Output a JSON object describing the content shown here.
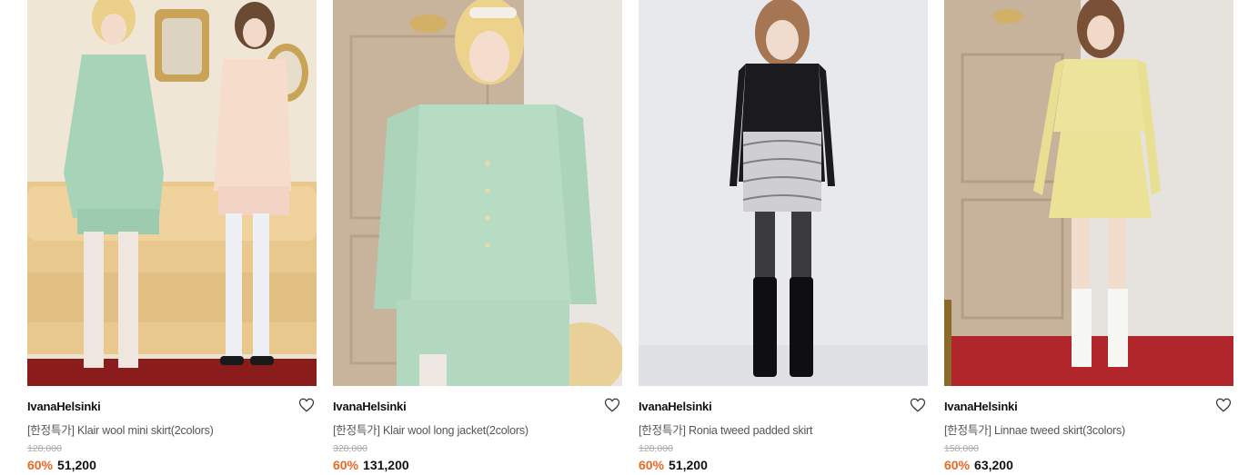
{
  "products": [
    {
      "brand": "IvanaHelsinki",
      "title": "[한정특가] Klair wool mini skirt(2colors)",
      "original_price": "128,000",
      "discount": "60%",
      "price": "51,200",
      "heart_icon": "heart-outline-icon"
    },
    {
      "brand": "IvanaHelsinki",
      "title": "[한정특가] Klair wool long jacket(2colors)",
      "original_price": "328,000",
      "discount": "60%",
      "price": "131,200",
      "heart_icon": "heart-outline-icon"
    },
    {
      "brand": "IvanaHelsinki",
      "title": "[한정특가] Ronia tweed padded skirt",
      "original_price": "128,000",
      "discount": "60%",
      "price": "51,200",
      "heart_icon": "heart-outline-icon"
    },
    {
      "brand": "IvanaHelsinki",
      "title": "[한정특가] Linnae tweed skirt(3colors)",
      "original_price": "158,000",
      "discount": "60%",
      "price": "63,200",
      "heart_icon": "heart-outline-icon"
    }
  ],
  "colors": {
    "discount": "#f26522",
    "original_price": "#aaaaaa",
    "brand": "#111111"
  }
}
